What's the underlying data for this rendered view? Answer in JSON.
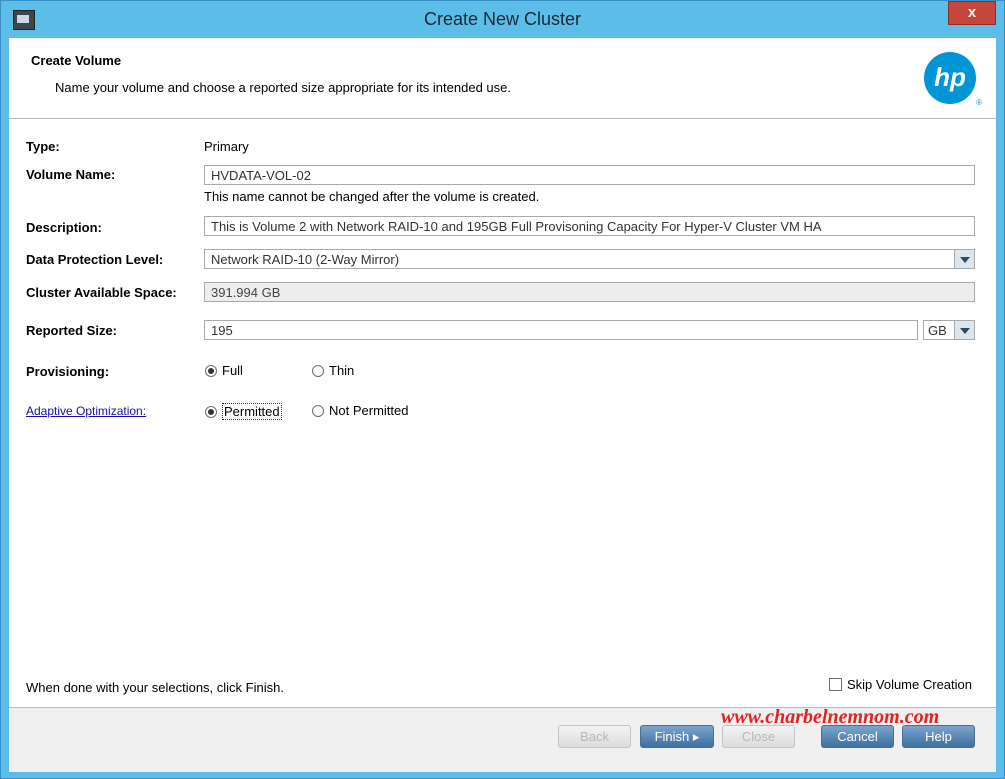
{
  "window": {
    "title": "Create New Cluster",
    "close_label": "x"
  },
  "header": {
    "title": "Create Volume",
    "subtitle": "Name your volume and choose a reported size appropriate for its intended use.",
    "logo_text": "hp",
    "logo_reg": "®"
  },
  "form": {
    "type": {
      "label": "Type:",
      "value": "Primary"
    },
    "volume_name": {
      "label": "Volume Name:",
      "value": "HVDATA-VOL-02",
      "note": "This name cannot be changed after the volume is created."
    },
    "description": {
      "label": "Description:",
      "value": "This is Volume 2 with Network RAID-10 and 195GB Full Provisoning Capacity For Hyper-V Cluster VM HA"
    },
    "data_protection": {
      "label": "Data Protection Level:",
      "value": "Network RAID-10 (2-Way Mirror)"
    },
    "cluster_space": {
      "label": "Cluster Available Space:",
      "value": "391.994 GB"
    },
    "reported_size": {
      "label": "Reported Size:",
      "value": "195",
      "unit": "GB"
    },
    "provisioning": {
      "label": "Provisioning:",
      "options": [
        "Full",
        "Thin"
      ],
      "selected": "Full"
    },
    "adaptive": {
      "label": "Adaptive Optimization:",
      "options": [
        "Permitted",
        "Not Permitted"
      ],
      "selected": "Permitted"
    }
  },
  "footer": {
    "instruction": "When done with your selections, click Finish.",
    "skip_label": "Skip Volume Creation",
    "watermark": "www.charbelnemnom.com",
    "buttons": {
      "back": "Back",
      "finish": "Finish",
      "close": "Close",
      "cancel": "Cancel",
      "help": "Help"
    }
  },
  "colors": {
    "titlebar": "#5bbde8",
    "close": "#c7463b",
    "button": "#3f6f9f",
    "watermark": "#e32222",
    "link": "#1a0dab",
    "logo": "#0096d6"
  }
}
